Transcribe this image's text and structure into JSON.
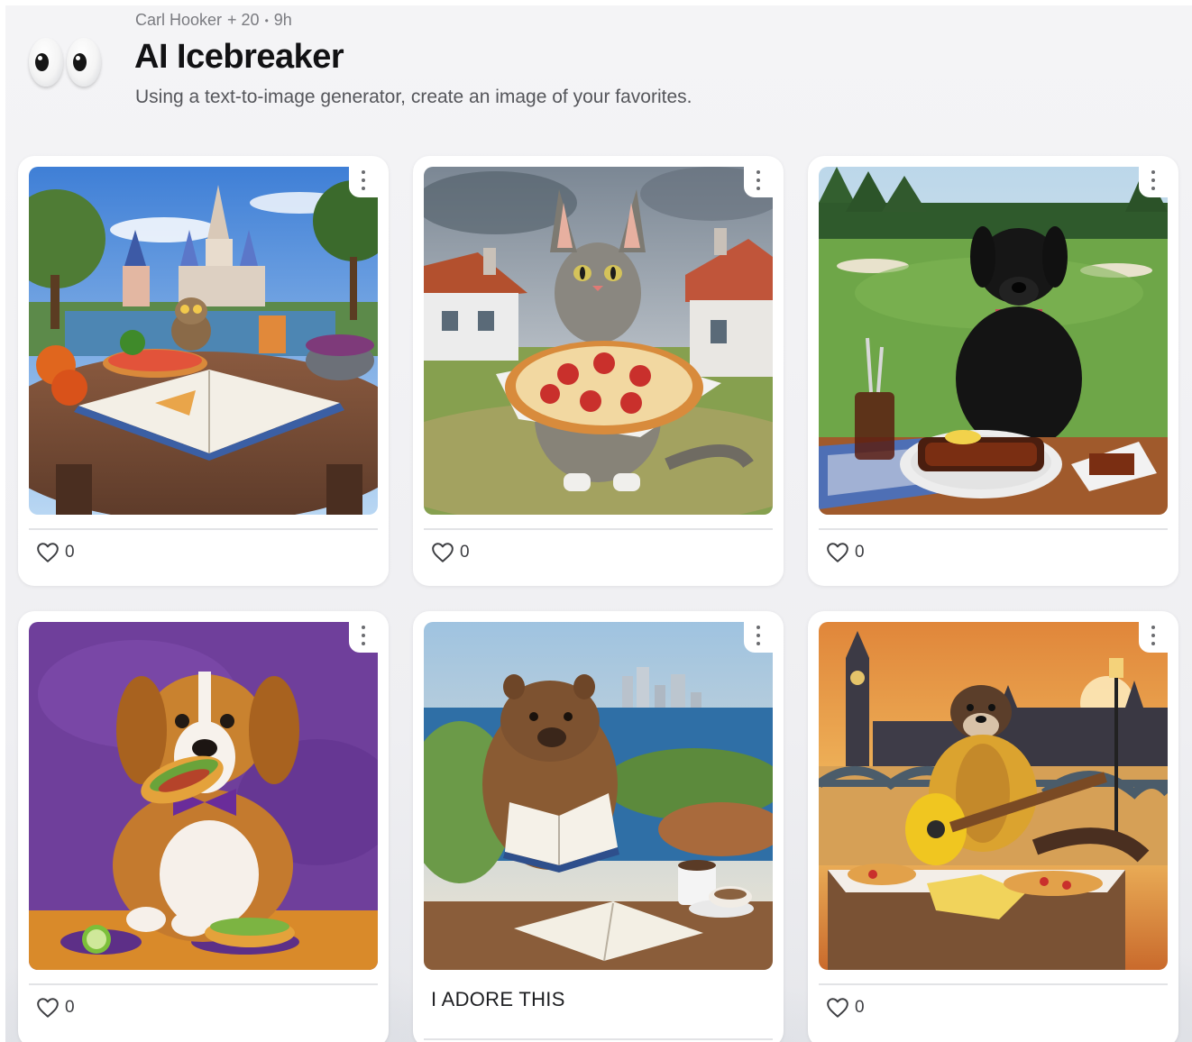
{
  "post": {
    "author": "Carl Hooker",
    "contributors": "+ 20",
    "time": "9h",
    "title": "AI Icebreaker",
    "prompt": "Using a text-to-image generator, create an image of your favorites."
  },
  "colors": {
    "background": "#f1f1f4",
    "card": "#ffffff",
    "text": "#1b1b1f",
    "muted": "#7a7b80"
  },
  "icons": {
    "avatar": "eyes-emoji-icon",
    "menu": "kebab-menu-icon",
    "like": "heart-outline-icon"
  },
  "cards": [
    {
      "image": "Owl at a table with pizza, open book and drink in front of a fairytale castle",
      "likes": "0"
    },
    {
      "image": "Watercolor tabby cat holding a pizza in a village",
      "likes": "0"
    },
    {
      "image": "Black labrador at a table with ribs and iced tea on a golf course",
      "likes": "0"
    },
    {
      "image": "Beagle with purple bow tie eating a taco on a purple background",
      "likes": "0"
    },
    {
      "image": "Wombat reading a book by the sea with a city skyline",
      "caption": "I ADORE THIS"
    },
    {
      "image": "Otter in a yellow jacket playing guitar with pizza in front of Big Ben",
      "likes": "0"
    }
  ]
}
